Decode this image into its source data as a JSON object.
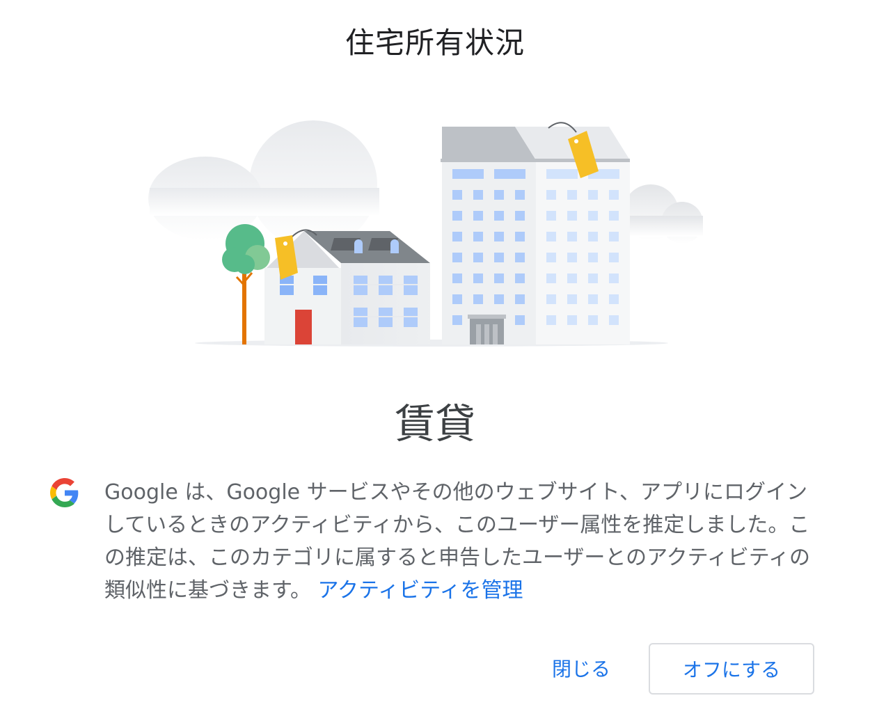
{
  "dialog": {
    "title": "住宅所有状況",
    "value": "賃貸",
    "description": "Google は、Google サービスやその他のウェブサイト、アプリにログインしているときのアクティビティから、このユーザー属性を推定しました。この推定は、このカテゴリに属すると申告したユーザーとのアクティビティの類似性に基づきます。",
    "manage_link": "アクティビティを管理",
    "close_label": "閉じる",
    "turn_off_label": "オフにする"
  },
  "colors": {
    "link": "#1a73e8",
    "title": "#202124",
    "body_text": "#5f6368",
    "google_blue": "#4285f4",
    "google_red": "#ea4335",
    "google_yellow": "#fbbc05",
    "google_green": "#34a853"
  },
  "icons": {
    "brand": "google-g-icon"
  }
}
